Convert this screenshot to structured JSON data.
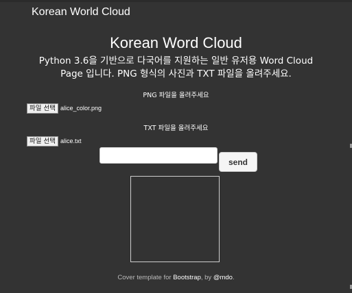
{
  "navbar": {
    "brand": "Korean World Cloud"
  },
  "main": {
    "title": "Korean Word Cloud",
    "description_line1": "Python 3.6을 기반으로 다국어를 지원하는 일반 유저용 Word Cloud",
    "description_line2": "Page 입니다. PNG 형식의 사진과 TXT 파일을 올려주세요."
  },
  "png_upload": {
    "label": "PNG 파일을 올려주세요",
    "button_label": "파일 선택",
    "file_name": "alice_color.png"
  },
  "txt_upload": {
    "label": "TXT 파일을 올려주세요",
    "button_label": "파일 선택",
    "file_name": "alice.txt"
  },
  "form": {
    "text_value": "",
    "send_label": "send"
  },
  "footer": {
    "prefix": "Cover template for ",
    "link1": "Bootstrap",
    "middle": ", by ",
    "link2": "@mdo",
    "suffix": "."
  },
  "colors": {
    "background": "#333333",
    "text": "#ffffff"
  }
}
